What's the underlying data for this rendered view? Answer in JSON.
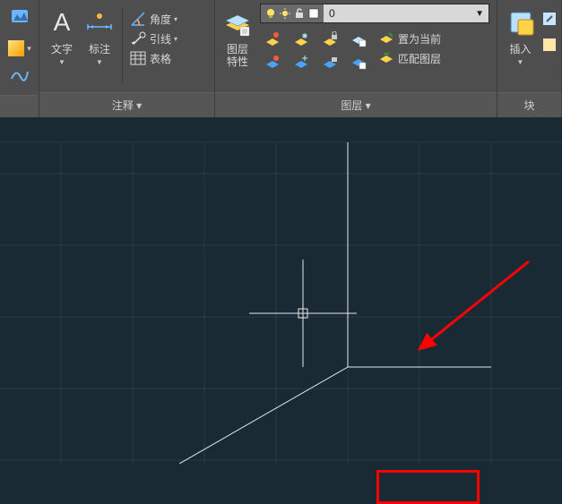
{
  "ribbon": {
    "annotate": {
      "label": "注释 ▾",
      "text_label": "文字",
      "dim_label": "标注",
      "angle_label": "角度",
      "leader_label": "引线",
      "table_label": "表格"
    },
    "layers": {
      "label": "图层 ▾",
      "props_label": "图层\n特性",
      "current_name": "0",
      "set_current_label": "置为当前",
      "match_label": "匹配图层"
    },
    "blocks": {
      "label": "块",
      "insert_label": "插入"
    }
  },
  "chart_data": null
}
